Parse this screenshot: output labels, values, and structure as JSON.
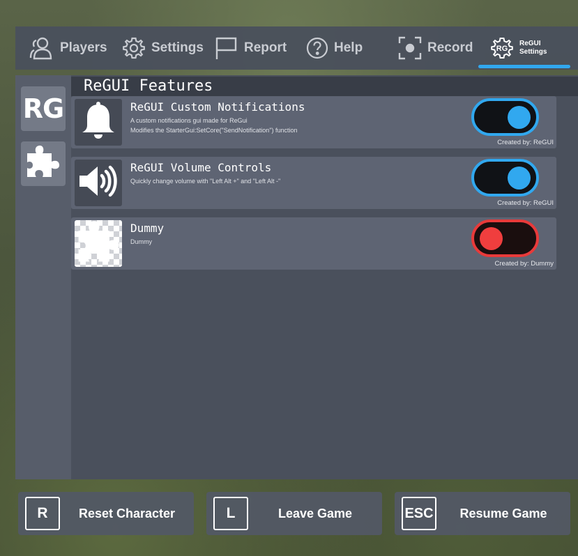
{
  "nav": {
    "players": "Players",
    "settings": "Settings",
    "report": "Report",
    "help": "Help",
    "record": "Record",
    "regui_settings_line1": "ReGUI",
    "regui_settings_line2": "Settings",
    "regui_icon_text": "RG"
  },
  "sidebar": {
    "logo_text": "RG",
    "plugin_icon": "puzzle-icon"
  },
  "features": {
    "title": "ReGUI Features",
    "items": [
      {
        "title": "ReGUI Custom Notifications",
        "desc1": "A custom notifications gui made for ReGui",
        "desc2": "Modifies the StarterGui:SetCore(\"SendNotification\") function",
        "credit": "Created by: ReGUI",
        "icon": "bell-icon",
        "enabled": true
      },
      {
        "title": "ReGUI Volume Controls",
        "desc1": "Quickly change volume with \"Left Alt +\" and \"Left Alt -\"",
        "desc2": "",
        "credit": "Created by: ReGUI",
        "icon": "speaker-icon",
        "enabled": true
      },
      {
        "title": "Dummy",
        "desc1": "Dummy",
        "desc2": "",
        "credit": "Created by: Dummy",
        "icon": "puzzle-icon",
        "enabled": false
      }
    ]
  },
  "bottom": {
    "reset_key": "R",
    "reset_label": "Reset Character",
    "leave_key": "L",
    "leave_label": "Leave Game",
    "resume_key": "ESC",
    "resume_label": "Resume Game"
  },
  "colors": {
    "accent_on": "#31a8ef",
    "accent_off": "#f03e3e",
    "panel": "#4a505c",
    "card": "#5e6473"
  }
}
